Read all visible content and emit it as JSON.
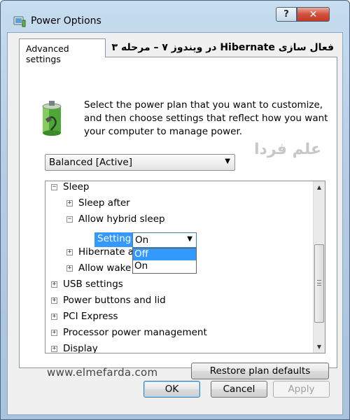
{
  "window": {
    "title": "Power Options",
    "help_label": "?",
    "close_label": "✕"
  },
  "tab": {
    "label": "Advanced settings"
  },
  "overlay": {
    "title": "فعال سازی Hibernate در ویندوز ۷ – مرحله ۳",
    "watermark": "علم فردا",
    "site_url": "www.elmefarda.com"
  },
  "description": "Select the power plan that you want to customize, and then choose settings that reflect how you want your computer to manage power.",
  "plan_select": {
    "value": "Balanced [Active]"
  },
  "tree": {
    "items": [
      {
        "label": "Sleep",
        "expanded": true
      },
      {
        "label": "Sleep after",
        "expanded": false
      },
      {
        "label": "Allow hybrid sleep",
        "expanded": true
      },
      {
        "label": "Hibernate af",
        "expanded": false
      },
      {
        "label": "Allow wake timers",
        "expanded": false
      },
      {
        "label": "USB settings",
        "expanded": false
      },
      {
        "label": "Power buttons and lid",
        "expanded": false
      },
      {
        "label": "PCI Express",
        "expanded": false
      },
      {
        "label": "Processor power management",
        "expanded": false
      },
      {
        "label": "Display",
        "expanded": false
      }
    ],
    "setting": {
      "label": "Setting:",
      "value": "On",
      "options": [
        "Off",
        "On"
      ],
      "highlighted_option": "Off"
    }
  },
  "buttons": {
    "restore": "Restore plan defaults",
    "ok": "OK",
    "cancel": "Cancel",
    "apply": "Apply"
  },
  "colors": {
    "selection": "#3399ff",
    "title_bar": "#b6cde4",
    "close_button": "#c23a24"
  }
}
